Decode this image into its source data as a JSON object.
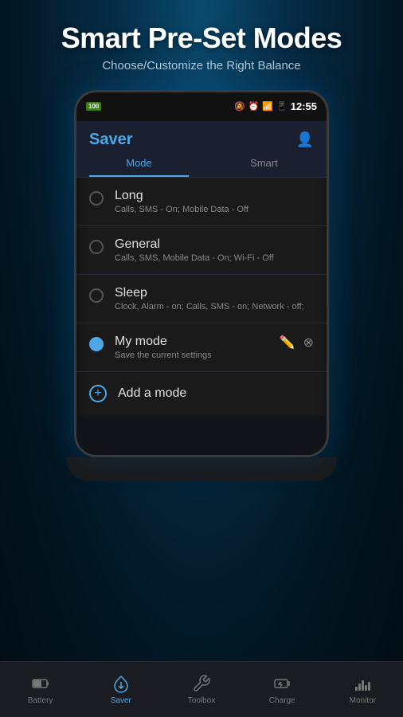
{
  "header": {
    "title": "Smart Pre-Set Modes",
    "subtitle": "Choose/Customize the Right Balance"
  },
  "phone": {
    "status_bar": {
      "battery_label": "100",
      "time": "12:55"
    },
    "app": {
      "title": "Saver",
      "tabs": [
        {
          "id": "mode",
          "label": "Mode",
          "active": true
        },
        {
          "id": "smart",
          "label": "Smart",
          "active": false
        }
      ],
      "modes": [
        {
          "id": "long",
          "name": "Long",
          "desc": "Calls, SMS - On; Mobile Data - Off",
          "selected": false
        },
        {
          "id": "general",
          "name": "General",
          "desc": "Calls, SMS, Mobile Data - On; Wi-Fi - Off",
          "selected": false
        },
        {
          "id": "sleep",
          "name": "Sleep",
          "desc": "Clock, Alarm - on; Calls, SMS - on; Network - off;",
          "selected": false
        },
        {
          "id": "mymode",
          "name": "My mode",
          "desc": "Save the current settings",
          "selected": true
        }
      ],
      "add_mode_label": "Add a mode"
    }
  },
  "bottom_nav": {
    "items": [
      {
        "id": "battery",
        "label": "Battery",
        "icon": "🔋",
        "active": false
      },
      {
        "id": "saver",
        "label": "Saver",
        "icon": "⬆",
        "active": true
      },
      {
        "id": "toolbox",
        "label": "Toolbox",
        "icon": "⚙",
        "active": false
      },
      {
        "id": "charge",
        "label": "Charge",
        "icon": "⚡",
        "active": false
      },
      {
        "id": "monitor",
        "label": "Monitor",
        "icon": "📊",
        "active": false
      }
    ]
  }
}
